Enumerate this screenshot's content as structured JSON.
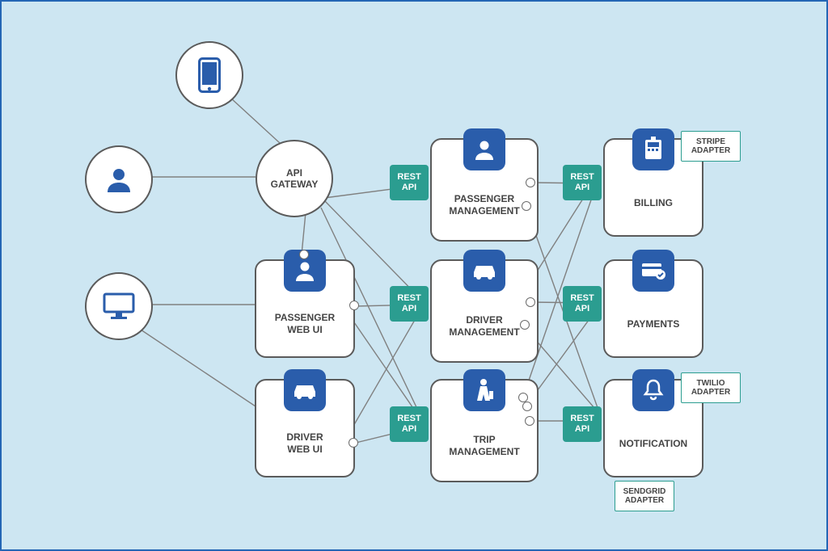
{
  "gateway_label": "API\nGATEWAY",
  "rest_label": "REST\nAPI",
  "services": {
    "passenger_web_ui": "PASSENGER\nWEB UI",
    "driver_web_ui": "DRIVER\nWEB UI",
    "passenger_mgmt": "PASSENGER\nMANAGEMENT",
    "driver_mgmt": "DRIVER\nMANAGEMENT",
    "trip_mgmt": "TRIP\nMANAGEMENT",
    "billing": "BILLING",
    "payments": "PAYMENTS",
    "notification": "NOTIFICATION"
  },
  "adapters": {
    "stripe": "STRIPE\nADAPTER",
    "twilio": "TWILIO\nADAPTER",
    "sendgrid": "SENDGRID\nADAPTER"
  },
  "colors": {
    "accent": "#2a5dab",
    "teal": "#2b9d90",
    "border": "#5b5b5b",
    "bg": "#cde6f2"
  }
}
